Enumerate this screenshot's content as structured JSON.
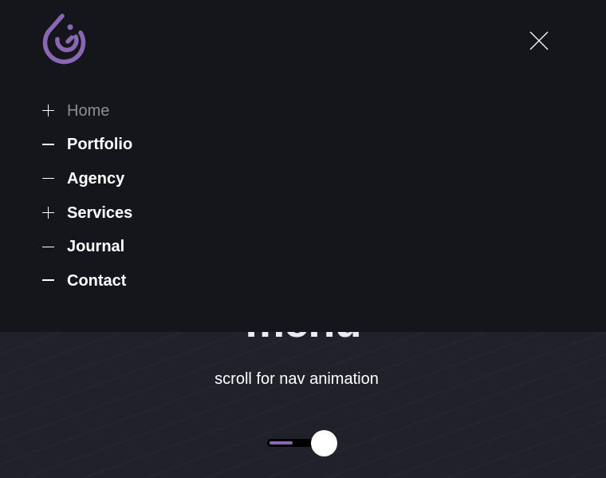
{
  "hero": {
    "title": "menu",
    "subtitle": "scroll for nav animation"
  },
  "slider": {
    "value_percent": 45,
    "fill_color": "#8a67b4"
  },
  "colors": {
    "panel": "#15161c",
    "background": "#21212b",
    "brand": "#8a67b4"
  },
  "header": {
    "logo_icon": "swirl-logo",
    "close_icon": "close-x"
  },
  "nav": {
    "items": [
      {
        "label": "Home",
        "icon": "plus",
        "active": false
      },
      {
        "label": "Portfolio",
        "icon": "minus"
      },
      {
        "label": "Agency",
        "icon": "minus-thin"
      },
      {
        "label": "Services",
        "icon": "plus"
      },
      {
        "label": "Journal",
        "icon": "minus-thin"
      },
      {
        "label": "Contact",
        "icon": "minus"
      }
    ]
  }
}
